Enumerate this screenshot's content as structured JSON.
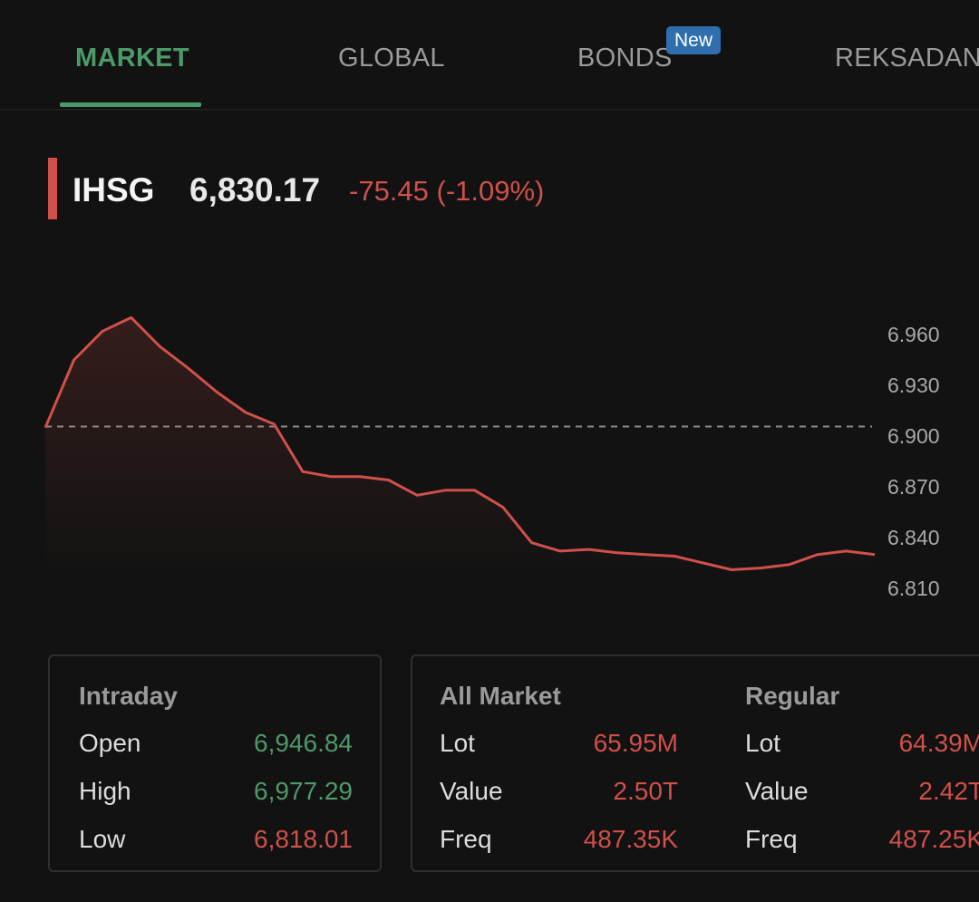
{
  "tabs": [
    {
      "label": "MARKET",
      "active": true
    },
    {
      "label": "GLOBAL",
      "active": false
    },
    {
      "label": "BONDS",
      "active": false,
      "badge": "New"
    },
    {
      "label": "REKSADANA",
      "active": false
    }
  ],
  "index": {
    "name": "IHSG",
    "value": "6,830.17",
    "change": "-75.45 (-1.09%)"
  },
  "colors": {
    "accent_green": "#4c9a6a",
    "down_red": "#d0504a",
    "badge_blue": "#2f6fb0",
    "background": "#121212"
  },
  "chart_data": {
    "type": "area",
    "y_tick_labels": [
      "6.960",
      "6.930",
      "6.900",
      "6.870",
      "6.840",
      "6.810"
    ],
    "y_ticks": [
      6960,
      6930,
      6900,
      6870,
      6840,
      6810
    ],
    "reference_line": 6905.62,
    "reference_line_style": "dashed",
    "values": [
      6905,
      6945,
      6962,
      6970,
      6953,
      6940,
      6926,
      6914,
      6907,
      6879,
      6876,
      6876,
      6874,
      6865,
      6868,
      6868,
      6858,
      6837,
      6832,
      6833,
      6831,
      6830,
      6829,
      6825,
      6821,
      6822,
      6824,
      6830,
      6832,
      6830
    ],
    "ylim": [
      6810,
      6975
    ]
  },
  "intraday": {
    "title": "Intraday",
    "rows": [
      {
        "label": "Open",
        "value": "6,946.84",
        "trend": "up"
      },
      {
        "label": "High",
        "value": "6,977.29",
        "trend": "up"
      },
      {
        "label": "Low",
        "value": "6,818.01",
        "trend": "down"
      }
    ]
  },
  "all_market": {
    "title": "All Market",
    "rows": [
      {
        "label": "Lot",
        "value": "65.95M"
      },
      {
        "label": "Value",
        "value": "2.50T"
      },
      {
        "label": "Freq",
        "value": "487.35K"
      }
    ]
  },
  "regular": {
    "title": "Regular",
    "rows": [
      {
        "label": "Lot",
        "value": "64.39M"
      },
      {
        "label": "Value",
        "value": "2.42T"
      },
      {
        "label": "Freq",
        "value": "487.25K"
      }
    ]
  }
}
